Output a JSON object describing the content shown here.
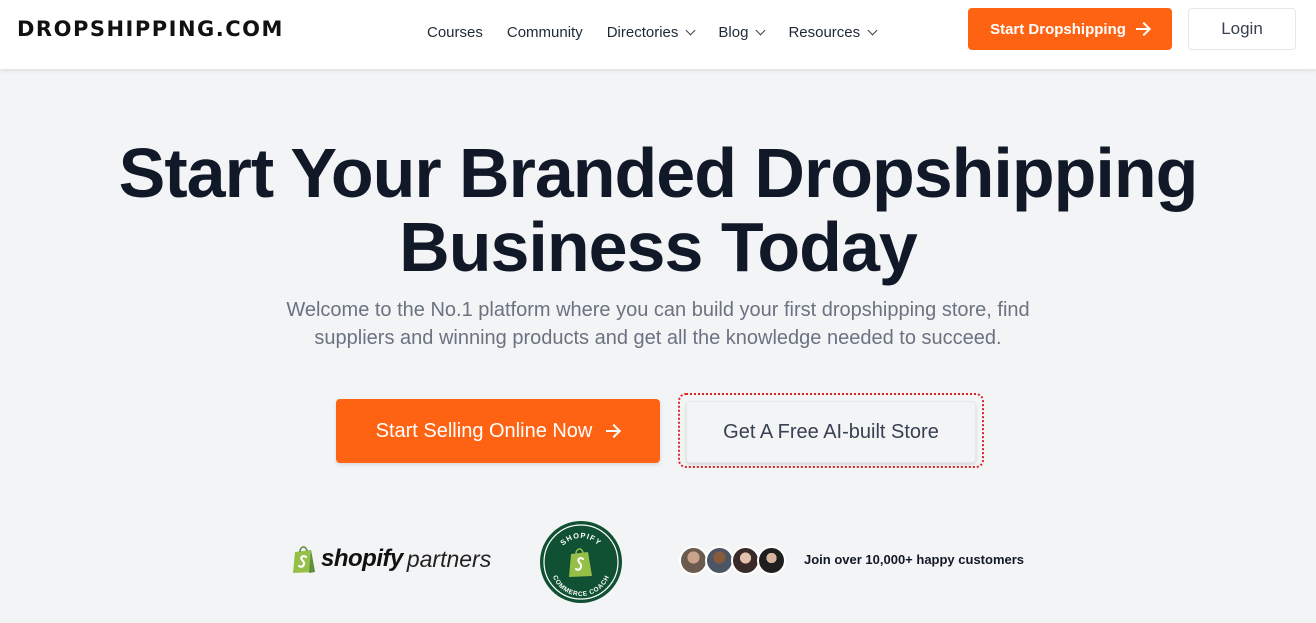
{
  "header": {
    "logo": "DROPSHIPPING.COM",
    "nav": [
      {
        "label": "Courses",
        "dropdown": false
      },
      {
        "label": "Community",
        "dropdown": false
      },
      {
        "label": "Directories",
        "dropdown": true
      },
      {
        "label": "Blog",
        "dropdown": true
      },
      {
        "label": "Resources",
        "dropdown": true
      }
    ],
    "cta_label": "Start Dropshipping",
    "login_label": "Login"
  },
  "hero": {
    "title_line1": "Start Your Branded Dropshipping",
    "title_line2": "Business Today",
    "subtitle_line1": "Welcome to the No.1 platform where you can build your first dropshipping store, find",
    "subtitle_line2": "suppliers and winning products and get all the knowledge needed to succeed.",
    "primary_button": "Start Selling Online Now",
    "secondary_button": "Get A Free AI-built Store"
  },
  "trust": {
    "shopify_word": "shopify",
    "partners_word": "partners",
    "badge_top": "SHOPIFY",
    "badge_bottom": "COMMERCE COACH",
    "customers_text": "Join over 10,000+ happy customers"
  },
  "colors": {
    "accent": "#fe6313",
    "shopify_green": "#95bf47",
    "badge_green": "#0f5132"
  }
}
